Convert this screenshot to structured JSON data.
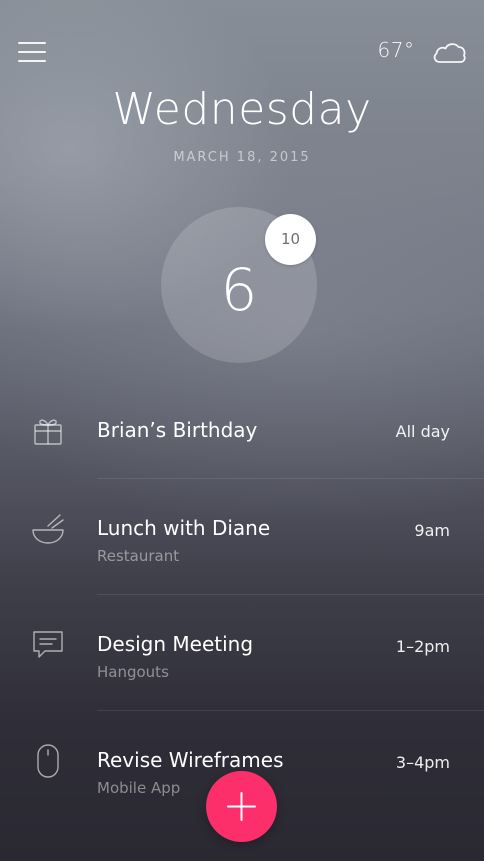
{
  "header": {
    "temperature": "67°",
    "weather_icon": "cloud-icon",
    "menu_icon": "hamburger-menu-icon"
  },
  "day": {
    "name": "Wednesday",
    "date": "MARCH 18, 2015"
  },
  "summary": {
    "count": "6",
    "badge": "10"
  },
  "events": [
    {
      "icon": "gift-icon",
      "title": "Brian’s Birthday",
      "subtitle": "",
      "time": "All day"
    },
    {
      "icon": "bowl-icon",
      "title": "Lunch with Diane",
      "subtitle": "Restaurant",
      "time": "9am"
    },
    {
      "icon": "chat-icon",
      "title": "Design Meeting",
      "subtitle": "Hangouts",
      "time": "1–2pm"
    },
    {
      "icon": "mouse-icon",
      "title": "Revise Wireframes",
      "subtitle": "Mobile App",
      "time": "3–4pm"
    }
  ],
  "fab": {
    "icon": "plus-icon"
  },
  "colors": {
    "accent": "#fd2f6b",
    "text": "#ffffff"
  }
}
